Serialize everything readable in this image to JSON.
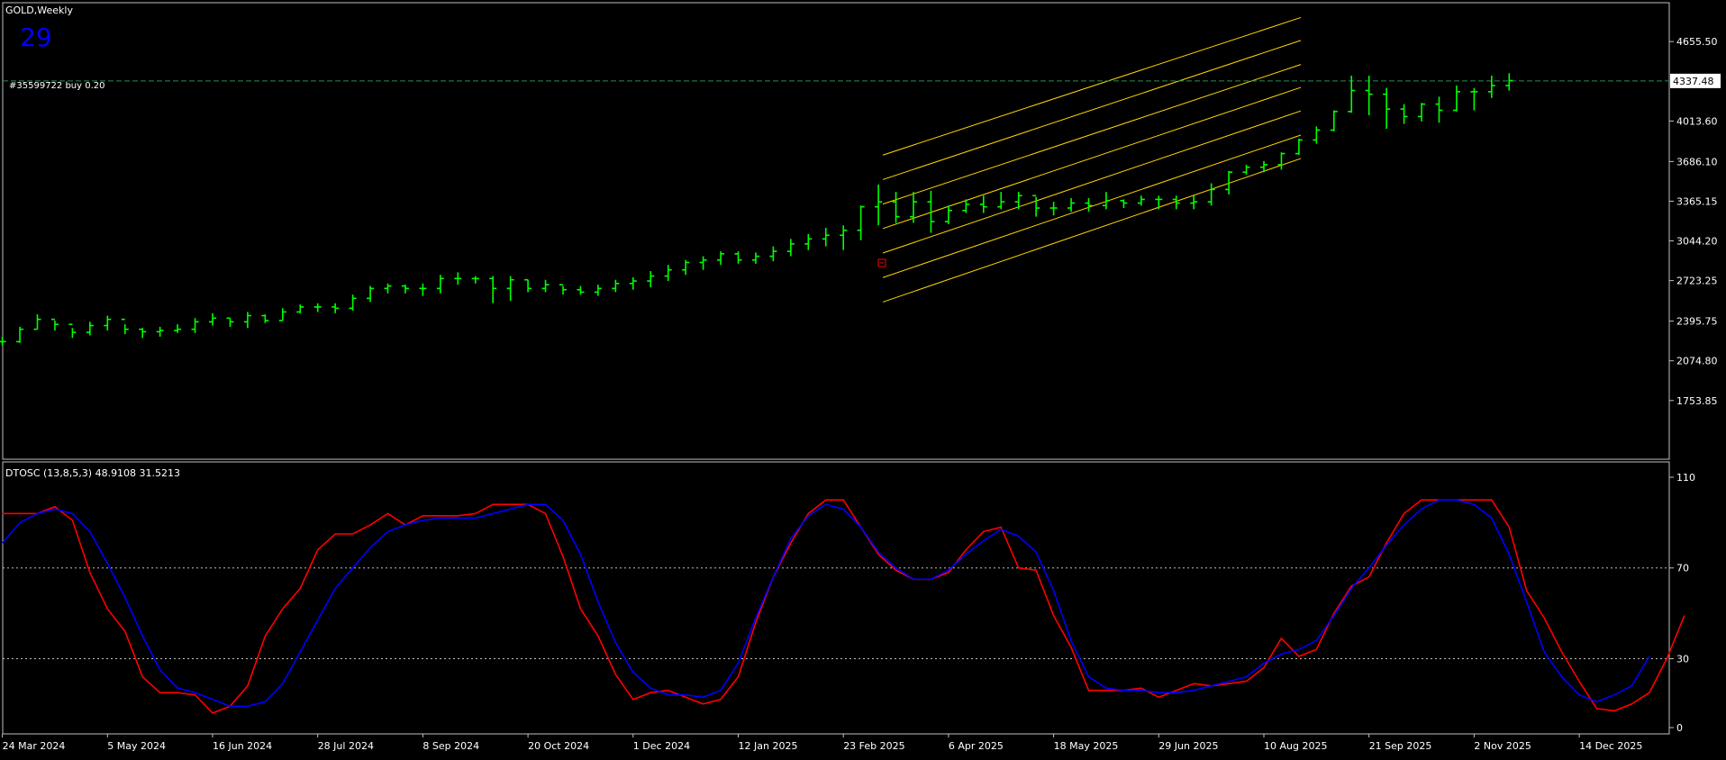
{
  "header": {
    "symbol_label": "GOLD,Weekly",
    "countdown": "29",
    "order_label": "#35599722 buy 0.20",
    "indicator_label": "DTOSC (13,8,5,3) 48.9108 31.5213"
  },
  "colors": {
    "background": "#000000",
    "frame": "#c0c0c0",
    "bars": "#00ff00",
    "channel": "#ffd700",
    "order_line": "#2e8b57",
    "fast_line": "#ff0000",
    "slow_line": "#0000ff",
    "countdown": "#0000ff",
    "levels": "#c0c0c0"
  },
  "chart_data": [
    {
      "type": "ohlc",
      "title": "GOLD,Weekly",
      "yticks": [
        "4655.50",
        "4013.60",
        "3686.10",
        "3365.15",
        "3044.20",
        "2723.25",
        "2395.75",
        "2074.80",
        "1753.85"
      ],
      "ylim": [
        1700,
        4870
      ],
      "current_price": "4337.48",
      "order": {
        "label": "#35599722 buy 0.20",
        "price": 4337.48
      },
      "xticks": [
        "24 Mar 2024",
        "5 May 2024",
        "16 Jun 2024",
        "28 Jul 2024",
        "8 Sep 2024",
        "20 Oct 2024",
        "1 Dec 2024",
        "12 Jan 2025",
        "23 Feb 2025",
        "6 Apr 2025",
        "18 May 2025",
        "29 Jun 2025",
        "10 Aug 2025",
        "21 Sep 2025",
        "2 Nov 2025",
        "14 Dec 2025"
      ],
      "close": [
        2230,
        2330,
        2410,
        2370,
        2305,
        2360,
        2410,
        2330,
        2310,
        2320,
        2330,
        2390,
        2420,
        2390,
        2440,
        2400,
        2470,
        2510,
        2510,
        2500,
        2580,
        2660,
        2680,
        2660,
        2660,
        2740,
        2740,
        2740,
        2660,
        2730,
        2660,
        2690,
        2650,
        2630,
        2660,
        2700,
        2720,
        2760,
        2810,
        2870,
        2890,
        2940,
        2890,
        2920,
        2960,
        3020,
        3060,
        3090,
        3130,
        3320,
        3360,
        3240,
        3360,
        3200,
        3290,
        3340,
        3320,
        3360,
        3410,
        3310,
        3310,
        3350,
        3330,
        3370,
        3350,
        3380,
        3380,
        3350,
        3360,
        3460,
        3600,
        3640,
        3660,
        3750,
        3860,
        3940,
        4090,
        4260,
        4230,
        4110,
        4050,
        4150,
        4100,
        4250,
        4250,
        4300,
        4340
      ],
      "high": [
        2270,
        2350,
        2450,
        2400,
        2340,
        2390,
        2440,
        2370,
        2340,
        2350,
        2370,
        2420,
        2460,
        2420,
        2470,
        2450,
        2500,
        2530,
        2540,
        2540,
        2610,
        2680,
        2700,
        2690,
        2700,
        2770,
        2790,
        2760,
        2760,
        2760,
        2730,
        2730,
        2680,
        2680,
        2690,
        2730,
        2750,
        2800,
        2850,
        2890,
        2920,
        2960,
        2960,
        2950,
        3000,
        3060,
        3100,
        3150,
        3170,
        3330,
        3500,
        3440,
        3440,
        3450,
        3330,
        3380,
        3410,
        3440,
        3440,
        3400,
        3360,
        3390,
        3390,
        3440,
        3380,
        3410,
        3410,
        3410,
        3410,
        3510,
        3610,
        3660,
        3690,
        3760,
        3870,
        3970,
        4100,
        4380,
        4380,
        4280,
        4150,
        4160,
        4210,
        4300,
        4280,
        4380,
        4400
      ],
      "low": [
        2200,
        2220,
        2330,
        2320,
        2260,
        2280,
        2320,
        2290,
        2260,
        2270,
        2300,
        2300,
        2360,
        2350,
        2340,
        2380,
        2400,
        2460,
        2470,
        2460,
        2480,
        2550,
        2620,
        2620,
        2600,
        2620,
        2690,
        2700,
        2540,
        2560,
        2630,
        2630,
        2610,
        2610,
        2600,
        2630,
        2650,
        2670,
        2720,
        2770,
        2810,
        2850,
        2860,
        2860,
        2880,
        2920,
        2970,
        3000,
        2970,
        3050,
        3170,
        3190,
        3190,
        3110,
        3180,
        3270,
        3270,
        3300,
        3300,
        3240,
        3250,
        3280,
        3280,
        3300,
        3310,
        3330,
        3300,
        3300,
        3300,
        3330,
        3420,
        3580,
        3600,
        3620,
        3740,
        3830,
        3930,
        4080,
        4060,
        3950,
        3990,
        4010,
        4000,
        4090,
        4100,
        4200,
        4260
      ],
      "channel_lines": [
        {
          "start": 3738,
          "end": 4850
        },
        {
          "start": 3540,
          "end": 4665
        },
        {
          "start": 3342,
          "end": 4470
        },
        {
          "start": 3144,
          "end": 4285
        },
        {
          "start": 2946,
          "end": 4095
        },
        {
          "start": 2748,
          "end": 3900
        },
        {
          "start": 2550,
          "end": 3710
        }
      ]
    },
    {
      "type": "line",
      "title": "DTOSC (13,8,5,3) 48.9108 31.5213",
      "ylim": [
        0,
        110
      ],
      "yticks": [
        "110",
        "70",
        "30",
        "0"
      ],
      "levels": [
        70,
        30
      ],
      "series": [
        {
          "values": [
            94,
            94,
            94,
            97,
            91,
            68,
            52,
            42,
            22,
            15,
            15,
            14,
            6,
            9,
            18,
            40,
            52,
            61,
            78,
            85,
            85,
            89,
            94,
            89,
            93,
            93,
            93,
            94,
            98,
            98,
            98,
            94,
            75,
            52,
            40,
            23,
            12,
            15,
            16,
            13,
            10,
            12,
            22,
            46,
            66,
            81,
            94,
            100,
            100,
            88,
            76,
            69,
            65,
            65,
            68,
            78,
            86,
            88,
            70,
            69,
            49,
            35,
            16,
            16,
            16,
            17,
            13,
            16,
            19,
            18,
            19,
            20,
            26,
            39,
            31,
            34,
            50,
            62,
            66,
            81,
            94,
            100,
            100,
            100,
            100,
            100,
            88,
            60,
            48,
            33,
            20,
            8,
            7,
            10,
            15,
            30,
            49
          ]
        },
        {
          "values": [
            81,
            90,
            94,
            96,
            94,
            86,
            72,
            57,
            40,
            25,
            17,
            15,
            12,
            9,
            9,
            11,
            19,
            33,
            47,
            61,
            70,
            79,
            86,
            89,
            91,
            92,
            92,
            92,
            94,
            96,
            98,
            98,
            91,
            76,
            55,
            37,
            24,
            17,
            14,
            14,
            13,
            16,
            28,
            48,
            66,
            83,
            93,
            98,
            96,
            88,
            77,
            70,
            65,
            65,
            69,
            76,
            82,
            87,
            84,
            77,
            60,
            38,
            22,
            17,
            16,
            16,
            15,
            15,
            16,
            18,
            20,
            22,
            28,
            32,
            34,
            38,
            49,
            61,
            70,
            80,
            89,
            96,
            100,
            100,
            98,
            92,
            76,
            55,
            33,
            22,
            14,
            11,
            14,
            18,
            31
          ]
        }
      ]
    }
  ]
}
